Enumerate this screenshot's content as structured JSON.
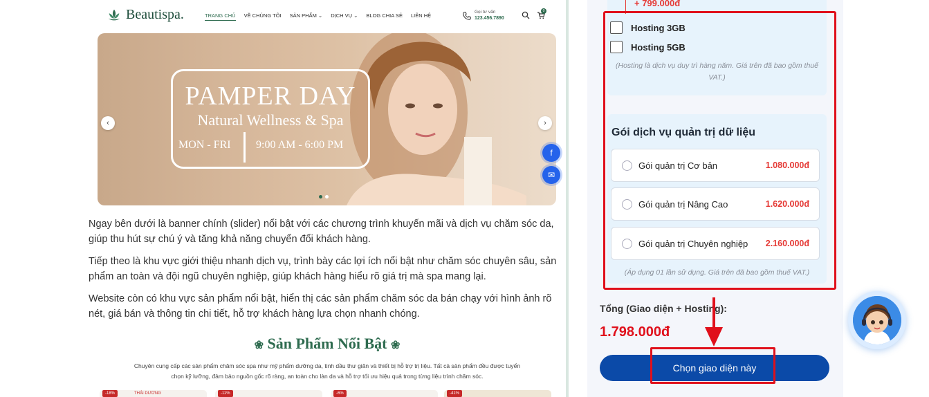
{
  "site": {
    "logo_text": "Beautispa.",
    "nav": [
      "TRANG CHỦ",
      "VỀ CHÚNG TÔI",
      "SẢN PHẨM",
      "DỊCH VỤ",
      "BLOG CHIA SẺ",
      "LIÊN HỆ"
    ],
    "hotline_label": "Gọi tư vấn",
    "hotline_number": "123.456.7890",
    "cart_count": "0"
  },
  "banner": {
    "title": "PAMPER DAY",
    "subtitle": "Natural Wellness & Spa",
    "days": "MON - FRI",
    "hours": "9:00 AM - 6:00 PM"
  },
  "description": [
    "Ngay bên dưới là banner chính (slider) nổi bật với các chương trình khuyến mãi và dịch vụ chăm sóc da, giúp thu hút sự chú ý và tăng khả năng chuyển đổi khách hàng.",
    "Tiếp theo là khu vực giới thiệu nhanh dịch vụ, trình bày các lợi ích nổi bật như chăm sóc chuyên sâu, sản phẩm an toàn và đội ngũ chuyên nghiệp, giúp khách hàng hiểu rõ giá trị mà spa mang lại.",
    "Website còn có khu vực sản phẩm nổi bật, hiển thị các sản phẩm chăm sóc da bán chạy với hình ảnh rõ nét, giá bán và thông tin chi tiết, hỗ trợ khách hàng lựa chọn nhanh chóng."
  ],
  "products": {
    "title": "Sản Phẩm Nổi Bật",
    "desc": "Chuyên cung cấp các sản phẩm chăm sóc spa như mỹ phẩm dưỡng da, tinh dầu thư giãn và thiết bị hỗ trợ trị liệu. Tất cả sản phẩm đều được tuyển chọn kỹ lưỡng, đảm bảo nguồn gốc rõ ràng, an toàn cho làn da và hỗ trợ tối ưu hiệu quả trong từng liệu trình chăm sóc.",
    "badges": [
      "-18%",
      "-11%",
      "-6%",
      "-41%"
    ],
    "first_brand": "THÁI DƯƠNG"
  },
  "pricing": {
    "addon_price": "+ 799.000đ",
    "hosting_options": [
      {
        "label": "Hosting 3GB",
        "checked": false
      },
      {
        "label": "Hosting 5GB",
        "checked": false
      }
    ],
    "hosting_note": "(Hosting là dịch vụ duy trì hàng năm. Giá trên đã bao gồm thuế VAT.)",
    "service_title": "Gói dịch vụ quản trị dữ liệu",
    "service_options": [
      {
        "label": "Gói quản trị Cơ bản",
        "price": "1.080.000đ"
      },
      {
        "label": "Gói quản trị Nâng Cao",
        "price": "1.620.000đ"
      },
      {
        "label": "Gói quản trị Chuyên nghiệp",
        "price": "2.160.000đ"
      }
    ],
    "service_note": "(Áp dụng 01 lần sử dụng. Giá trên đã bao gồm thuế VAT.)",
    "total_label": "Tổng (Giao diện + Hosting):",
    "total_value": "1.798.000đ",
    "cta_label": "Chọn giao diện này"
  },
  "colors": {
    "brand_green": "#2e6b4f",
    "price_red": "#e53935",
    "cta_blue": "#0b4aa8",
    "highlight_red": "#e0101b"
  }
}
